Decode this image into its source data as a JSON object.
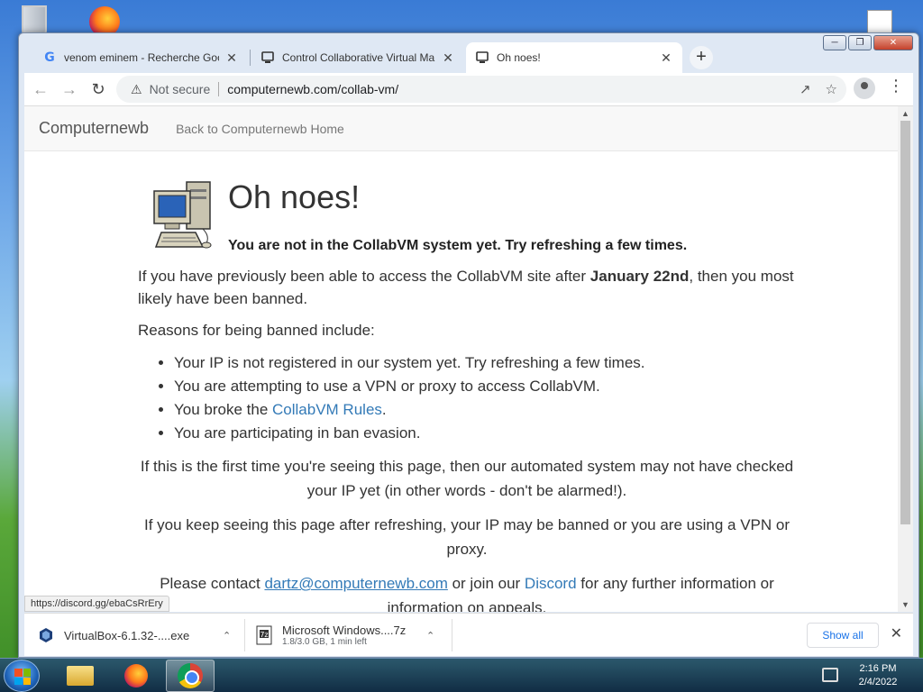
{
  "colors": {
    "link": "#337ab7",
    "close_button": "#c4412b",
    "show_all": "#1a73e8"
  },
  "desktop": {
    "icons": [
      "recycle-bin-icon",
      "firefox-icon",
      "file-icon"
    ]
  },
  "tabs": [
    {
      "title": "venom eminem - Recherche Goo",
      "favicon": "google-icon",
      "active": false
    },
    {
      "title": "Control Collaborative Virtual Ma",
      "favicon": "collabvm-icon",
      "active": false
    },
    {
      "title": "Oh noes!",
      "favicon": "collabvm-icon",
      "active": true
    }
  ],
  "toolbar": {
    "security_label": "Not secure",
    "url": "computernewb.com/collab-vm/"
  },
  "site": {
    "brand": "Computernewb",
    "home_link": "Back to Computernewb Home"
  },
  "page": {
    "heading": "Oh noes!",
    "subheading": "You are not in the CollabVM system yet. Try refreshing a few times.",
    "para1_before": "If you have previously been able to access the CollabVM site after ",
    "para1_bold": "January 22nd",
    "para1_after": ", then you most likely have been banned.",
    "para2": "Reasons for being banned include:",
    "reason1": "Your IP is not registered in our system yet. Try refreshing a few times.",
    "reason2": "You are attempting to use a VPN or proxy to access CollabVM.",
    "reason3_before": "You broke the ",
    "reason3_link": "CollabVM Rules",
    "reason3_after": ".",
    "reason4": "You are participating in ban evasion.",
    "para3": "If this is the first time you're seeing this page, then our automated system may not have checked your IP yet (in other words - don't be alarmed!).",
    "para4": "If you keep seeing this page after refreshing, your IP may be banned or you are using a VPN or proxy.",
    "para5_before": "Please contact ",
    "para5_email": "dartz@computernewb.com",
    "para5_mid": " or join our ",
    "para5_discord": "Discord",
    "para5_after": " for any further information or information on appeals."
  },
  "status_url": "https://discord.gg/ebaCsRrEry",
  "downloads": {
    "item1_name": "VirtualBox-6.1.32-....exe",
    "item2_name": "Microsoft Windows....7z",
    "item2_sub": "1.8/3.0 GB, 1 min left",
    "show_all": "Show all"
  },
  "taskbar": {
    "time": "2:16 PM",
    "date": "2/4/2022"
  }
}
